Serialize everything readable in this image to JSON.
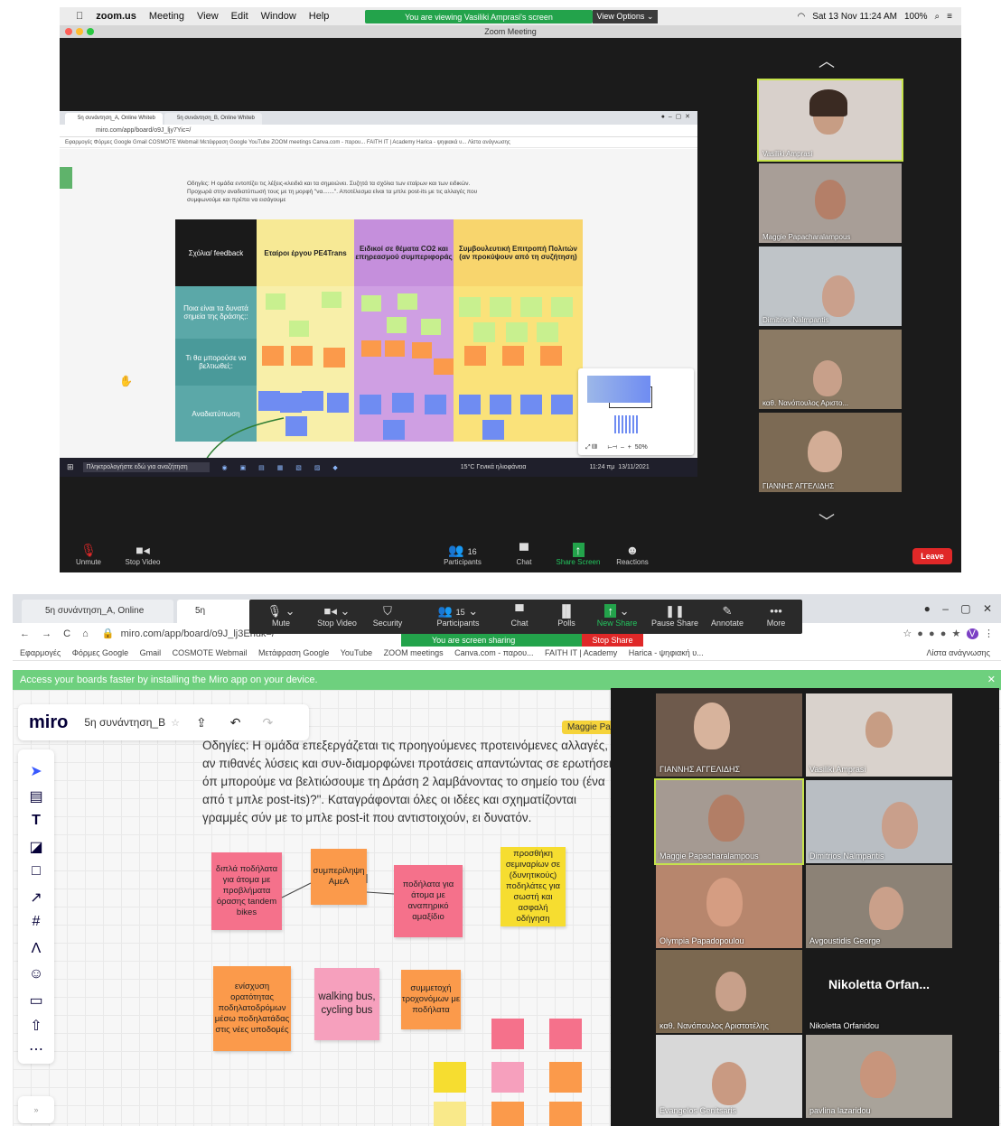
{
  "top_panel": {
    "menubar": {
      "app": "zoom.us",
      "items": [
        "Meeting",
        "View",
        "Edit",
        "Window",
        "Help"
      ],
      "banner": "You are viewing Vasiliki Amprasi's screen",
      "view_options": "View Options ⌄",
      "datetime": "Sat 13 Nov  11:24 AM",
      "battery": "100%"
    },
    "window_title": "Zoom Meeting",
    "shared_screen": {
      "tabs": [
        "5η συνάντηση_A, Online Whiteb",
        "5η συνάντηση_B, Online Whiteb"
      ],
      "url": "miro.com/app/board/o9J_ljy7Yic=/",
      "bookmarks": "Εφαρμογές   Φόρμες Google   Gmail   COSMOTE Webmail   Μετάφραση Google   YouTube   ZOOM meetings   Canva.com - παρου...   FAITH IT | Academy   Harica - ψηφιακά υ...   Λίστα ανάγνωσης",
      "instructions": "Οδηγίες: Η ομάδα εντοπίζει τις λέξεις-κλειδιά και τα σημειώνει. Συζητά τα σχόλια των εταίρων και των ειδικών. Προχωρά στην αναδιατύπωσή τους με τη μορφή \"να.......\". Αποτέλεσμα είναι τα μπλε post-its με τις αλλαγές που συμφωνούμε και πρέπει να εισάγουμε",
      "table": {
        "corner": "Σχόλια/ feedback",
        "columns": [
          "Εταίροι έργου PE4Trans",
          "Ειδικοί σε θέματα CO2 και επηρεασμού συμπεριφοράς",
          "Συμβουλευτική Επιτροπή Πολιτών (αν προκύψουν από τη συζήτηση)"
        ],
        "rows": [
          "Ποια είναι τα δυνατά σημεία της δράσης;:",
          "Τι θα μπορούσε να βελτιωθεί;:",
          "Αναδιατύπωση"
        ]
      },
      "taskbar": {
        "search": "Πληκτρολογήστε εδώ για αναζήτηση",
        "weather": "15°C  Γενικά ηλιοφάνεια",
        "time": "11:24 πμ",
        "date": "13/11/2021"
      },
      "minimap_zoom": "50%"
    },
    "gallery": [
      "Vasiliki Amprasi",
      "Maggie Papacharalampous",
      "Dimitrios Nalmpantis",
      "καθ. Νανόπουλος Αριστο...",
      "ΓΙΑΝΝΗΣ ΑΓΓΕΛΙΔΗΣ"
    ],
    "controls": {
      "unmute": "Unmute",
      "stop_video": "Stop Video",
      "participants": "Participants",
      "participants_count": "16",
      "chat": "Chat",
      "share_screen": "Share Screen",
      "reactions": "Reactions",
      "leave": "Leave"
    }
  },
  "bottom_panel": {
    "tabs": [
      "5η συνάντηση_A, Online Whiteb",
      "5η συνάντηση_"
    ],
    "url": "miro.com/app/board/o9J_lj3Ehuk=/",
    "bookmarks": [
      "Εφαρμογές",
      "Φόρμες Google",
      "Gmail",
      "COSMOTE Webmail",
      "Μετάφραση Google",
      "YouTube",
      "ZOOM meetings",
      "Canva.com - παρου...",
      "FAITH IT | Academy",
      "Harica - ψηφιακή υ...",
      "Λίστα ανάγνωσης"
    ],
    "zoom_toolbar": {
      "items": [
        "Mute",
        "Stop Video",
        "Security",
        "Participants",
        "Chat",
        "Polls",
        "New Share",
        "Pause Share",
        "Annotate",
        "More"
      ],
      "participants_count": "15",
      "sharing_banner": "You are screen sharing",
      "stop_share": "Stop Share"
    },
    "miro_banner": "Access your boards faster by installing the Miro app on your device.",
    "miro": {
      "logo": "miro",
      "board_name": "5η συνάντηση_B",
      "cursor_label": "Maggie Pap",
      "instructions": "Οδηγίες: Η ομάδα επεξεργάζεται τις προηγούμενες προτεινόμενες αλλαγές, αν πιθανές λύσεις και συν-διαμορφώνει προτάσεις απαντώντας σε ερωτήσεις όπ μπορούμε να βελτιώσουμε τη Δράση 2 λαμβάνοντας το σημείο του (ένα από τ μπλε post-its)?\".  Καταγράφονται όλες οι ιδέες και σχηματίζονται γραμμές σύν με το μπλε post-it που αντιστοιχούν, ει δυνατόν.",
      "stickies": [
        "διπλά ποδήλατα για άτομα με προβλήματα όρασης tandem bikes",
        "συμπερίληψη ΑμεΑ",
        "ποδήλατα για άτομα με αναπηρικό αμαξίδιο",
        "προσθήκη σεμιναρίων σε (δυνητικούς) ποδηλάτες για σωστή και ασφαλή οδήγηση",
        "ενίσχυση ορατότητας ποδηλατοδρόμων μέσω ποδηλατάδας στις νέες υποδομές",
        "walking bus, cycling bus",
        "συμμετοχή τροχονόμων με ποδήλατα"
      ]
    },
    "gallery": [
      "ΓΙΑΝΝΗΣ ΑΓΓΕΛΙΔΗΣ",
      "Vasiliki Amprasi",
      "Maggie Papacharalampous",
      "Dimitrios Nalmpantis",
      "Olympia Papadopoulou",
      "Avgoustidis George",
      "καθ. Νανόπουλος Αριστοτέλης",
      "Nikoletta Orfanidou",
      "Evangelos Genitsaris",
      "pavlina lazaridou"
    ],
    "nikoletta_tile": "Nikoletta  Orfan..."
  },
  "colors": {
    "zoom_green": "#23a34b",
    "miro_banner": "#6ed07e",
    "leave_red": "#e02828",
    "highlight": "#c6e34b"
  }
}
